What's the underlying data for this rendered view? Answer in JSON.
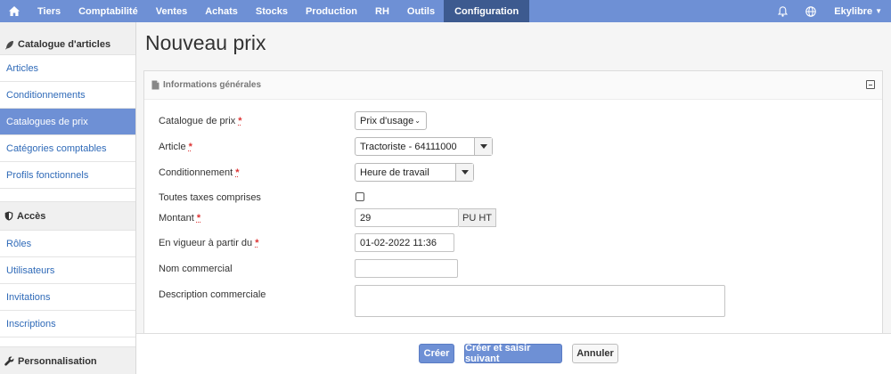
{
  "topnav": {
    "items": [
      "Tiers",
      "Comptabilité",
      "Ventes",
      "Achats",
      "Stocks",
      "Production",
      "RH",
      "Outils",
      "Configuration"
    ],
    "active": "Configuration",
    "user": "Ekylibre",
    "accent_color": "#6e90d5",
    "active_color": "#3d5a8f"
  },
  "sidebar": {
    "sections": [
      {
        "title": "Catalogue d'articles",
        "items": [
          "Articles",
          "Conditionnements",
          "Catalogues de prix",
          "Catégories comptables",
          "Profils fonctionnels"
        ]
      },
      {
        "title": "Accès",
        "items": [
          "Rôles",
          "Utilisateurs",
          "Invitations",
          "Inscriptions"
        ]
      },
      {
        "title": "Personnalisation",
        "items": []
      }
    ],
    "active_item": "Catalogues de prix"
  },
  "page": {
    "title": "Nouveau prix",
    "panel_title": "Informations générales"
  },
  "form": {
    "catalog_label": "Catalogue de prix",
    "catalog_value": "Prix d'usage",
    "article_label": "Article",
    "article_value": "Tractoriste - 64111000",
    "packaging_label": "Conditionnement",
    "packaging_value": "Heure de travail",
    "ttc_label": "Toutes taxes comprises",
    "ttc_checked": false,
    "amount_label": "Montant",
    "amount_value": "29",
    "amount_unit": "PU HT",
    "started_label": "En vigueur à partir du",
    "started_value": "01-02-2022 11:36",
    "commercial_name_label": "Nom commercial",
    "commercial_name_value": "",
    "commercial_desc_label": "Description commerciale",
    "commercial_desc_value": "",
    "required_mark": "*"
  },
  "actions": {
    "create": "Créer",
    "create_next": "Créer et saisir suivant",
    "cancel": "Annuler"
  }
}
